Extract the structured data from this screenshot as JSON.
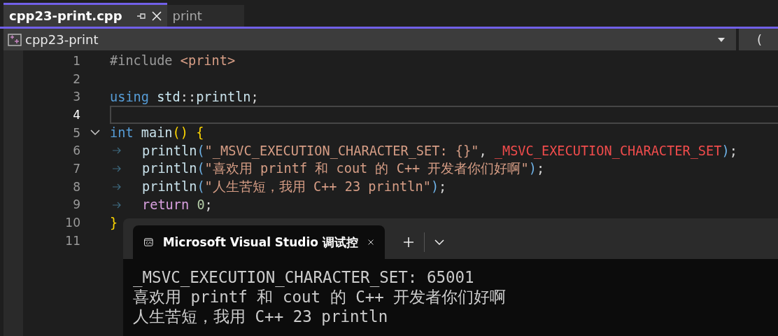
{
  "tabs": [
    {
      "label": "cpp23-print.cpp",
      "selected": true,
      "pinned": true
    },
    {
      "label": "print",
      "selected": false,
      "pinned": false
    }
  ],
  "navigation_bar": {
    "project": "cpp23-print",
    "member_fragment": "("
  },
  "editor": {
    "lines": [
      {
        "number": "1",
        "current": false,
        "tabbed": false,
        "tokens": [
          {
            "kind": "preproc",
            "text": "#include "
          },
          {
            "kind": "string",
            "text": "<print>"
          }
        ]
      },
      {
        "number": "2",
        "current": false,
        "tabbed": false
      },
      {
        "number": "3",
        "current": false,
        "tabbed": false,
        "tokens": [
          {
            "kind": "keyword",
            "text": "using "
          },
          {
            "kind": "namespace",
            "text": "std"
          },
          {
            "kind": "punct",
            "text": "::"
          },
          {
            "kind": "function",
            "text": "println"
          },
          {
            "kind": "punct",
            "text": ";"
          }
        ]
      },
      {
        "number": "4",
        "current": true,
        "tabbed": false
      },
      {
        "number": "5",
        "current": false,
        "tabbed": false,
        "expanded": true,
        "tokens": [
          {
            "kind": "keyword",
            "text": "int "
          },
          {
            "kind": "function",
            "text": "main"
          },
          {
            "kind": "paren",
            "text": "() {"
          }
        ]
      },
      {
        "number": "6",
        "current": false,
        "tabbed": true,
        "tokens": [
          {
            "kind": "function",
            "text": "println"
          },
          {
            "kind": "paren2",
            "text": "("
          },
          {
            "kind": "string",
            "text": "\"_MSVC_EXECUTION_CHARACTER_SET: {}\""
          },
          {
            "kind": "punct",
            "text": ", "
          },
          {
            "kind": "macro",
            "text": "_MSVC_EXECUTION_CHARACTER_SET"
          },
          {
            "kind": "paren2",
            "text": ")"
          },
          {
            "kind": "punct",
            "text": ";"
          }
        ]
      },
      {
        "number": "7",
        "current": false,
        "tabbed": true,
        "tokens": [
          {
            "kind": "function",
            "text": "println"
          },
          {
            "kind": "paren2",
            "text": "("
          },
          {
            "kind": "string",
            "text": "\"喜欢用 printf 和 cout 的 C++ 开发者你们好啊\""
          },
          {
            "kind": "paren2",
            "text": ")"
          },
          {
            "kind": "punct",
            "text": ";"
          }
        ]
      },
      {
        "number": "8",
        "current": false,
        "tabbed": true,
        "tokens": [
          {
            "kind": "function",
            "text": "println"
          },
          {
            "kind": "paren2",
            "text": "("
          },
          {
            "kind": "string",
            "text": "\"人生苦短，我用 C++ 23 println\""
          },
          {
            "kind": "paren2",
            "text": ")"
          },
          {
            "kind": "punct",
            "text": ";"
          }
        ]
      },
      {
        "number": "9",
        "current": false,
        "tabbed": true,
        "tokens": [
          {
            "kind": "control",
            "text": "return "
          },
          {
            "kind": "number",
            "text": "0"
          },
          {
            "kind": "punct",
            "text": ";"
          }
        ]
      },
      {
        "number": "10",
        "current": false,
        "tabbed": false,
        "tokens": [
          {
            "kind": "paren",
            "text": "}"
          }
        ]
      },
      {
        "number": "11",
        "current": false,
        "tabbed": false
      }
    ]
  },
  "terminal": {
    "tab_title": "Microsoft Visual Studio 调试控",
    "output": [
      "_MSVC_EXECUTION_CHARACTER_SET: 65001",
      "喜欢用 printf 和 cout 的 C++ 开发者你们好啊",
      "人生苦短，我用 C++ 23 println"
    ]
  }
}
